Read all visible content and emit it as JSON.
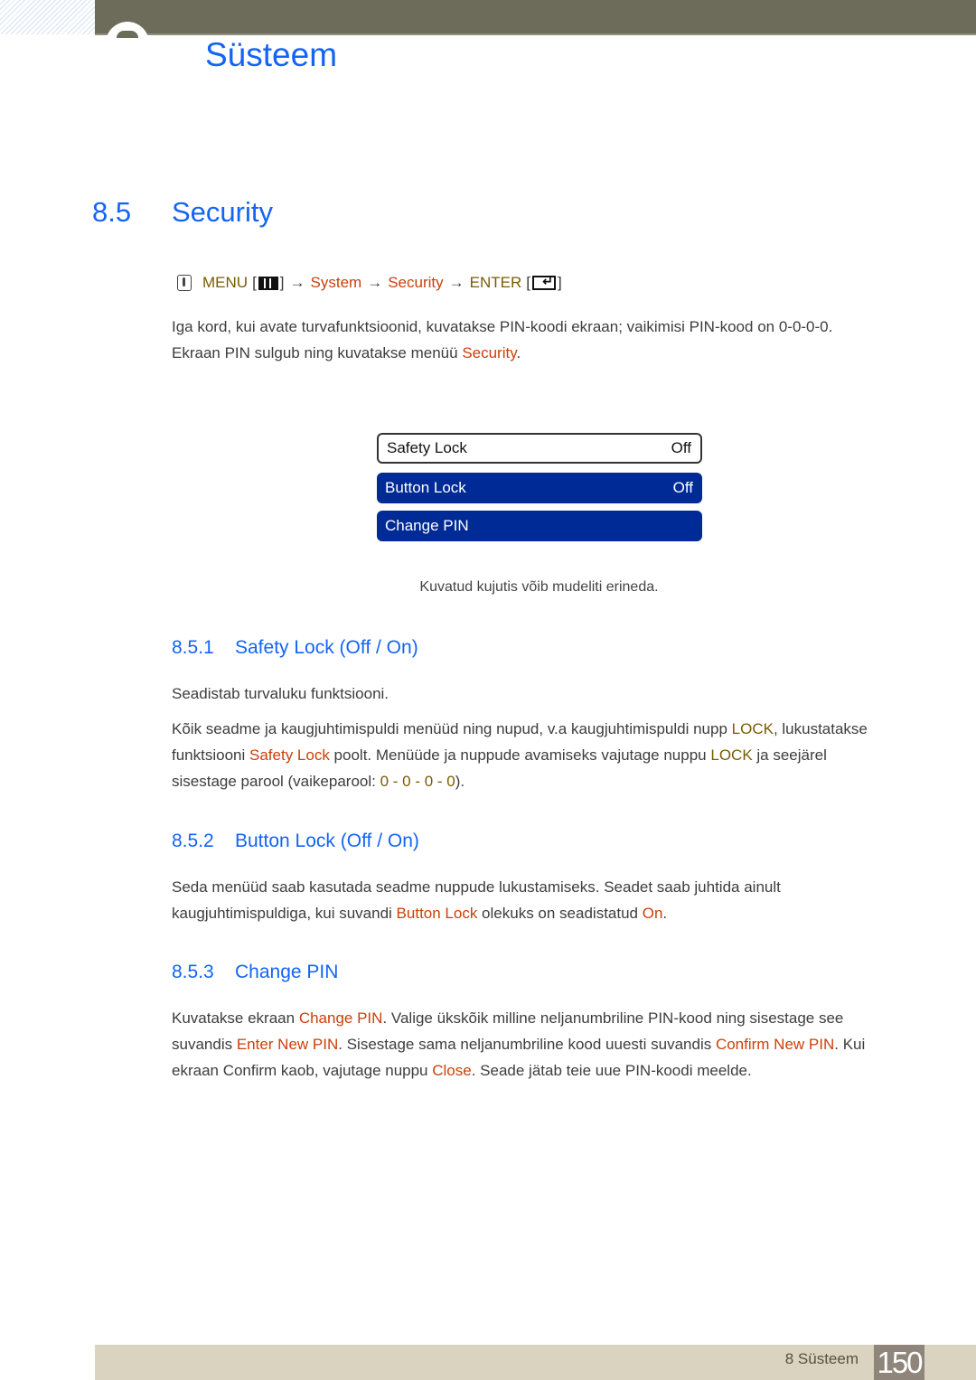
{
  "header": {
    "chapter_title": "Süsteem"
  },
  "section": {
    "number": "8.5",
    "title": "Security"
  },
  "menu_path": {
    "menu": "MENU",
    "system": "System",
    "security": "Security",
    "enter": "ENTER",
    "arrow": "→",
    "open_bracket": "[",
    "close_bracket": "]"
  },
  "intro": {
    "line1": "Iga kord, kui avate turvafunktsioonid, kuvatakse PIN-koodi ekraan; vaikimisi PIN-kood on 0-0-0-0.",
    "line2_pre": "Ekraan PIN sulgub ning kuvatakse menüü ",
    "line2_hl": "Security",
    "line2_post": "."
  },
  "osd_menu": {
    "items": [
      {
        "label": "Safety Lock",
        "value": "Off"
      },
      {
        "label": "Button Lock",
        "value": "Off"
      },
      {
        "label": "Change PIN",
        "value": ""
      }
    ]
  },
  "caption": "Kuvatud kujutis võib mudeliti erineda.",
  "subsections": [
    {
      "number": "8.5.1",
      "title": "Safety Lock (Off / On)",
      "p1": "Seadistab turvaluku funktsiooni.",
      "p2": {
        "t1": "Kõik seadme ja kaugjuhtimispuldi menüüd ning nupud, v.a kaugjuhtimispuldi nupp ",
        "h1": "LOCK",
        "t2": ", lukustatakse",
        "t3": "funktsiooni ",
        "h2": "Safety Lock",
        "t4": " poolt. Menüüde ja nuppude avamiseks vajutage nuppu ",
        "h3": "LOCK",
        "t5": " ja seejärel",
        "t6": "sisestage parool (vaikeparool: ",
        "h4": "0 - 0 - 0 - 0",
        "t7": ")."
      }
    },
    {
      "number": "8.5.2",
      "title": "Button Lock (Off / On)",
      "p1": {
        "t1": "Seda menüüd saab kasutada seadme nuppude lukustamiseks. Seadet saab juhtida ainult",
        "t2": "kaugjuhtimispuldiga, kui suvandi ",
        "h1": "Button Lock",
        "t3": " olekuks on seadistatud ",
        "h2": "On",
        "t4": "."
      }
    },
    {
      "number": "8.5.3",
      "title": "Change PIN",
      "p1": {
        "t1": "Kuvatakse ekraan ",
        "h1": "Change PIN",
        "t2": ". Valige ükskõik milline neljanumbriline PIN-kood ning sisestage see",
        "t3": "suvandis ",
        "h2": "Enter New PIN",
        "t4": ". Sisestage sama neljanumbriline kood uuesti suvandis ",
        "h3": "Confirm New PIN",
        "t5": ". Kui",
        "t6": "ekraan Confirm kaob, vajutage nuppu ",
        "h4": "Close",
        "t7": ". Seade jätab teie uue PIN-koodi meelde."
      }
    }
  ],
  "footer": {
    "label": "8 Süsteem",
    "page_number": "150"
  }
}
